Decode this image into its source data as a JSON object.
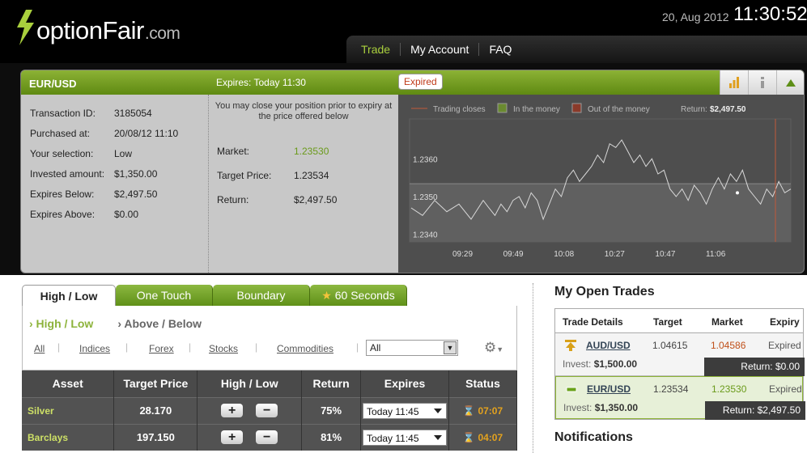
{
  "brand": {
    "name": "optionFair",
    "domain": ".com"
  },
  "header": {
    "date": "20, Aug 2012",
    "time": "11:30:52"
  },
  "nav": [
    {
      "label": "Trade"
    },
    {
      "label": "My Account"
    },
    {
      "label": "FAQ"
    }
  ],
  "position": {
    "pair": "EUR/USD",
    "expires_label": "Expires:",
    "expires_value": "Today 11:30",
    "status_badge": "Expired",
    "details": [
      {
        "label": "Transaction ID:",
        "value": "3185054"
      },
      {
        "label": "Purchased at:",
        "value": "20/08/12 11:10"
      },
      {
        "label": "Your selection:",
        "value": "Low"
      },
      {
        "label": "Invested amount:",
        "value": "$1,350.00"
      },
      {
        "label": "Expires Below:",
        "value": "$2,497.50"
      },
      {
        "label": "Expires Above:",
        "value": "$0.00"
      }
    ],
    "close_message": "You may close your position prior to expiry at the price offered below",
    "market_label": "Market:",
    "market_value": "1.23530",
    "target_label": "Target Price:",
    "target_value": "1.23534",
    "return_label": "Return:",
    "return_value": "$2,497.50"
  },
  "chart_data": {
    "type": "line",
    "legend": [
      "Trading closes",
      "In the money",
      "Out of the money"
    ],
    "return_label": "Return:",
    "return_value": "$2,497.50",
    "x_ticks": [
      "09:29",
      "09:49",
      "10:08",
      "10:27",
      "10:47",
      "11:06"
    ],
    "y_ticks": [
      "1.2360",
      "1.2350",
      "1.2340"
    ],
    "ylim": [
      1.2338,
      1.2368
    ],
    "target": 1.23534,
    "x": [
      0,
      0.02,
      0.04,
      0.06,
      0.08,
      0.1,
      0.12,
      0.14,
      0.16,
      0.18,
      0.2,
      0.22,
      0.24,
      0.26,
      0.28,
      0.3,
      0.32,
      0.34,
      0.36,
      0.38,
      0.4,
      0.42,
      0.44,
      0.46,
      0.48,
      0.5,
      0.52,
      0.54,
      0.56,
      0.58,
      0.6,
      0.62,
      0.64,
      0.66,
      0.68,
      0.7,
      0.72,
      0.74,
      0.76,
      0.78,
      0.8,
      0.82,
      0.84,
      0.86,
      0.88,
      0.9,
      0.92,
      0.94,
      0.96,
      0.98,
      1.0
    ],
    "values": [
      1.2347,
      1.2345,
      1.2348,
      1.2346,
      1.2349,
      1.235,
      1.2347,
      1.2351,
      1.2349,
      1.2344,
      1.2348,
      1.2352,
      1.235,
      1.2355,
      1.2357,
      1.2354,
      1.2356,
      1.2358,
      1.2361,
      1.2359,
      1.2364,
      1.2363,
      1.2365,
      1.2362,
      1.2359,
      1.2361,
      1.2358,
      1.236,
      1.2356,
      1.2357,
      1.2352,
      1.235,
      1.2352,
      1.2349,
      1.2353,
      1.2351,
      1.2348,
      1.2352,
      1.2355,
      1.2352,
      1.2356,
      1.2354,
      1.2357,
      1.2352,
      1.235,
      1.2348,
      1.2352,
      1.235,
      1.2354,
      1.2351,
      1.2352
    ]
  },
  "trade_tabs": [
    {
      "label": "High / Low"
    },
    {
      "label": "One Touch"
    },
    {
      "label": "Boundary"
    },
    {
      "label": "60 Seconds"
    }
  ],
  "sub_tabs": [
    "› High / Low",
    "› Above / Below"
  ],
  "filters": [
    "All",
    "Indices",
    "Forex",
    "Stocks",
    "Commodities"
  ],
  "filter_select": "All",
  "assets_table": {
    "headers": [
      "Asset",
      "Target Price",
      "High / Low",
      "Return",
      "Expires",
      "Status"
    ],
    "rows": [
      {
        "asset": "Silver",
        "target": "28.170",
        "ret": "75%",
        "expires": "Today 11:45",
        "status": "07:07"
      },
      {
        "asset": "Barclays",
        "target": "197.150",
        "ret": "81%",
        "expires": "Today 11:45",
        "status": "04:07"
      }
    ]
  },
  "open_trades": {
    "title": "My Open Trades",
    "headers": [
      "Trade Details",
      "Target",
      "Market",
      "Expiry"
    ],
    "rows": [
      {
        "pair": "AUD/USD",
        "invest_label": "Invest:",
        "invest": "$1,500.00",
        "target": "1.04615",
        "market": "1.04586",
        "market_color": "#c0501a",
        "expiry": "Expired",
        "return": "Return: $0.00"
      },
      {
        "pair": "EUR/USD",
        "invest_label": "Invest:",
        "invest": "$1,350.00",
        "target": "1.23534",
        "market": "1.23530",
        "market_color": "#6a9a1a",
        "expiry": "Expired",
        "return": "Return: $2,497.50"
      }
    ]
  },
  "notifications_title": "Notifications"
}
